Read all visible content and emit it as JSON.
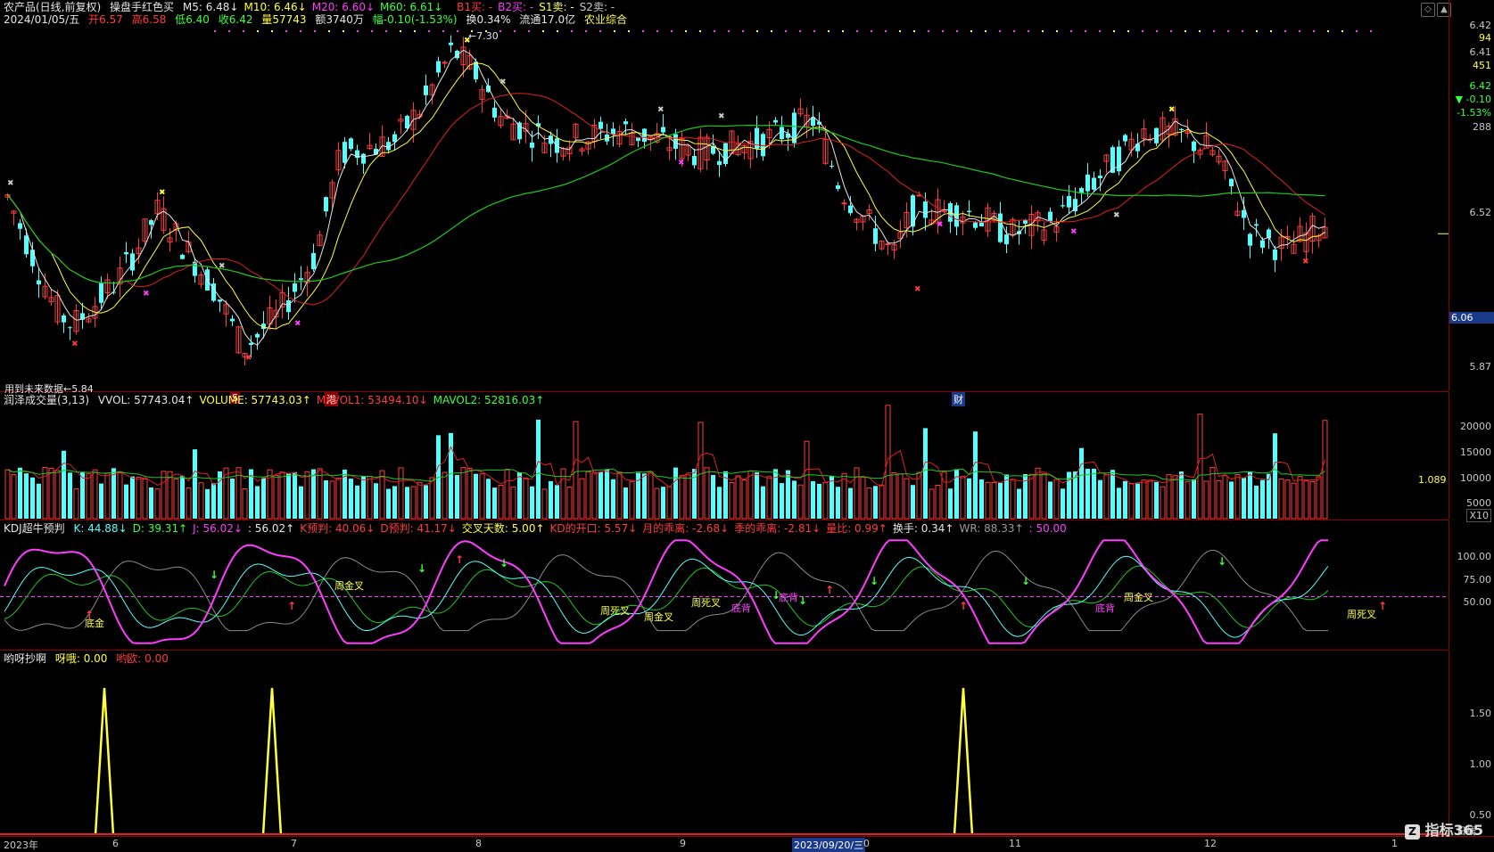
{
  "header": {
    "stock": "农产品(日线,前复权)",
    "indicator": "操盘手红色买",
    "ma": [
      {
        "label": "M5:",
        "value": "6.48",
        "arrow": "↓",
        "color": "#e6e6e6"
      },
      {
        "label": "M10:",
        "value": "6.46",
        "arrow": "↓",
        "color": "#ffff3c"
      },
      {
        "label": "M20:",
        "value": "6.60",
        "arrow": "↓",
        "color": "#ff3cff"
      },
      {
        "label": "M60:",
        "value": "6.61",
        "arrow": "↓",
        "color": "#3cff3c"
      }
    ],
    "signals": [
      {
        "label": "B1买:",
        "value": "-",
        "color": "#ff3c3c"
      },
      {
        "label": "B2买:",
        "value": "-",
        "color": "#ff3cff"
      },
      {
        "label": "S1卖:",
        "value": "-",
        "color": "#ffff3c"
      },
      {
        "label": "S2卖:",
        "value": "-",
        "color": "#c8c8c8"
      }
    ]
  },
  "quote": {
    "date": "2024/01/05/五",
    "open_label": "开",
    "open": "6.57",
    "high_label": "高",
    "high": "6.58",
    "low_label": "低",
    "low": "6.40",
    "close_label": "收",
    "close": "6.42",
    "vol_label": "量",
    "vol": "57743",
    "amt_label": "额",
    "amt": "3740万",
    "chg_label": "幅",
    "chg": "-0.10(-1.53%)",
    "turn_label": "换",
    "turn": "0.34%",
    "float_label": "流通",
    "float": "17.0亿",
    "sector": "农业综合"
  },
  "price_axis": {
    "ticks": [
      {
        "v": "6.42",
        "c": "#c8c8c8"
      },
      {
        "v": "94",
        "c": "#ffff3c"
      },
      {
        "v": "6.41",
        "c": "#c8c8c8"
      },
      {
        "v": "451",
        "c": "#ffff3c"
      },
      {
        "v": "6.42",
        "c": "#3cff3c"
      },
      {
        "v": "▼ -0.10",
        "c": "#3cff3c"
      },
      {
        "v": "-1.53%",
        "c": "#3cff3c"
      },
      {
        "v": "288",
        "c": "#c8c8c8"
      },
      {
        "v": "6.52",
        "c": "#c8c8c8"
      },
      {
        "v": "6.06",
        "c": "#ffffff"
      },
      {
        "v": "5.87",
        "c": "#c8c8c8"
      }
    ]
  },
  "chart_data": {
    "type": "candlestick",
    "price_range": [
      5.8,
      7.35
    ],
    "high_label": "7.30",
    "low_label": "5.84",
    "future_data_note": "用到未来数据",
    "markers": [
      {
        "text": "S"
      },
      {
        "text": "港"
      },
      {
        "text": "财"
      }
    ]
  },
  "volume_panel": {
    "title": "润泽成交量(3,13)",
    "items": [
      {
        "label": "VVOL:",
        "value": "57743.04",
        "arrow": "↑",
        "color": "#e6e6e6"
      },
      {
        "label": "VOLUME:",
        "value": "57743.03",
        "arrow": "↑",
        "color": "#ffff3c"
      },
      {
        "label": "MAVOL1:",
        "value": "53494.10",
        "arrow": "↓",
        "color": "#ff3c3c"
      },
      {
        "label": "MAVOL2:",
        "value": "52816.03",
        "arrow": "↑",
        "color": "#3cff3c"
      }
    ],
    "ticks": [
      "20000",
      "15000",
      "10000",
      "5000"
    ],
    "ratio": "1.089",
    "unit": "X10"
  },
  "kdj_panel": {
    "title": "KDJ超牛预判",
    "items": [
      {
        "label": "K:",
        "value": "44.88",
        "arrow": "↓",
        "color": "#54ffff"
      },
      {
        "label": "D:",
        "value": "39.31",
        "arrow": "↑",
        "color": "#3cff3c"
      },
      {
        "label": "J:",
        "value": "56.02",
        "arrow": "↓",
        "color": "#ff3cff"
      },
      {
        "label": ":",
        "value": "56.02",
        "arrow": "↑",
        "color": "#e6e6e6"
      },
      {
        "label": "K预判:",
        "value": "40.06",
        "arrow": "↓",
        "color": "#ff3c3c"
      },
      {
        "label": "D预判:",
        "value": "41.17",
        "arrow": "↓",
        "color": "#ff3c3c"
      },
      {
        "label": "交叉天数:",
        "value": "5.00",
        "arrow": "↑",
        "color": "#ffff3c"
      },
      {
        "label": "KD的开口:",
        "value": "5.57",
        "arrow": "↓",
        "color": "#ff3c3c"
      },
      {
        "label": "月的乖离:",
        "value": "-2.68",
        "arrow": "↓",
        "color": "#ff3c3c"
      },
      {
        "label": "季的乖离:",
        "value": "-2.81",
        "arrow": "↓",
        "color": "#ff3c3c"
      },
      {
        "label": "量比:",
        "value": "0.99",
        "arrow": "↑",
        "color": "#ff3c3c"
      },
      {
        "label": "换手:",
        "value": "0.34",
        "arrow": "↑",
        "color": "#e6e6e6"
      },
      {
        "label": "WR:",
        "value": "88.33",
        "arrow": "↑",
        "color": "#9a9a9a"
      },
      {
        "label": ":",
        "value": "50.00",
        "arrow": "",
        "color": "#ff3cff"
      }
    ],
    "ticks": [
      "100.00",
      "75.00",
      "50.00"
    ],
    "labels": [
      {
        "t": "底金"
      },
      {
        "t": "周金叉"
      },
      {
        "t": "周死叉"
      },
      {
        "t": "周金叉"
      },
      {
        "t": "周死叉"
      },
      {
        "t": "底背"
      },
      {
        "t": "底背"
      },
      {
        "t": "底背"
      },
      {
        "t": "周金叉"
      },
      {
        "t": "周死叉"
      }
    ]
  },
  "bottom_panel": {
    "title": "哟呀抄啊",
    "items": [
      {
        "label": "呀哦:",
        "value": "0.00",
        "color": "#ffff3c"
      },
      {
        "label": "哟欧:",
        "value": "0.00",
        "color": "#ff3c3c"
      }
    ],
    "ticks": [
      "1.50",
      "1.00",
      "0.50"
    ]
  },
  "date_axis": {
    "labels": [
      "2023年",
      "6",
      "7",
      "8",
      "9",
      "0",
      "11",
      "12",
      "1"
    ],
    "cursor_date": "2023/09/20/三",
    "period": "日线"
  },
  "watermark": "指标365"
}
